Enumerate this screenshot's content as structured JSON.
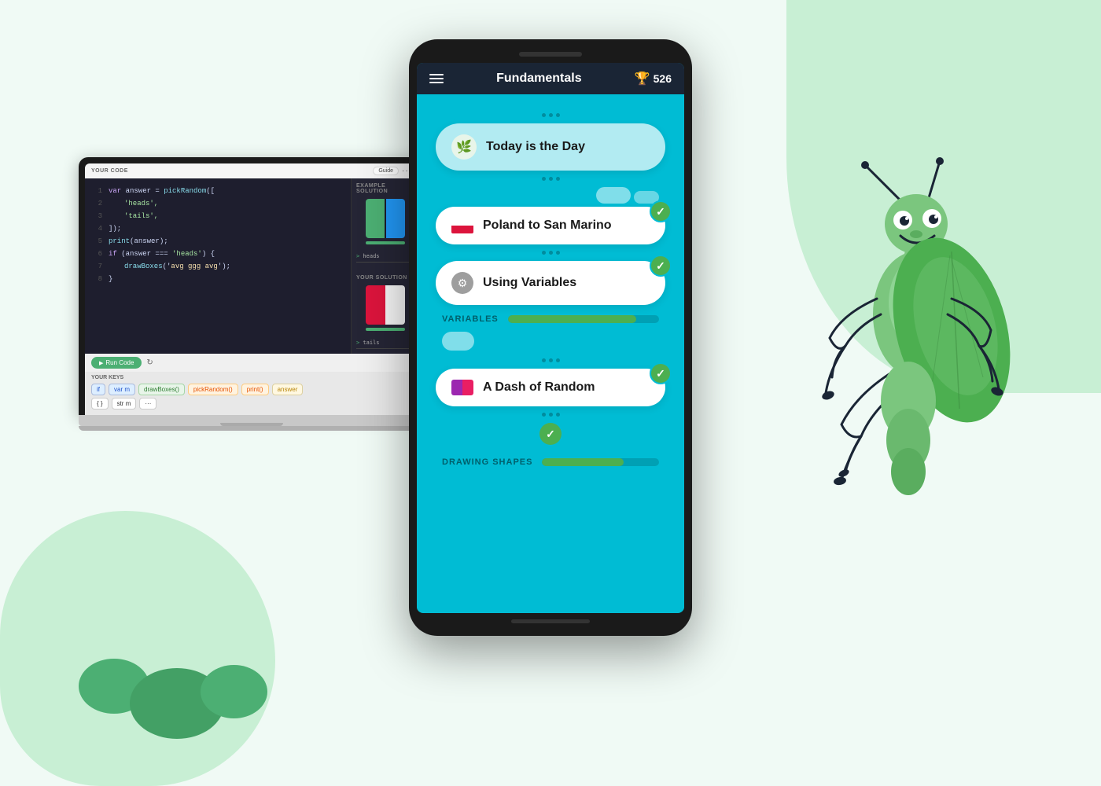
{
  "background": {
    "color": "#f0faf5"
  },
  "phone": {
    "title": "Fundamentals",
    "score": "526",
    "lessons": [
      {
        "id": "today",
        "title": "Today is the Day",
        "icon_type": "leaf",
        "completed": false,
        "active": true
      },
      {
        "id": "poland",
        "title": "Poland to San Marino",
        "icon_type": "flag",
        "completed": true
      },
      {
        "id": "variables",
        "title": "Using Variables",
        "icon_type": "gear",
        "completed": true
      },
      {
        "id": "dash",
        "title": "A Dash of Random",
        "icon_type": "purple",
        "completed": true
      }
    ],
    "sections": [
      {
        "id": "variables",
        "label": "VARIABLES",
        "progress": 85
      },
      {
        "id": "drawing",
        "label": "DRAWING SHAPES",
        "progress": 70
      }
    ]
  },
  "laptop": {
    "your_code_label": "YOUR CODE",
    "guide_label": "Guide",
    "example_solution_label": "EXAMPLE SOLUTION",
    "your_solution_label": "YOUR SOLUTION",
    "run_code_label": "Run Code",
    "your_keys_label": "YOUR KEYS",
    "code_lines": [
      "var answer = pickRandom([",
      "    'heads',",
      "    'tails',",
      "]);",
      "print(answer);",
      "if (answer === 'heads') {",
      "    drawBoxes('avg ggg avg');",
      "}"
    ],
    "keys": [
      {
        "label": "if",
        "type": "blue"
      },
      {
        "label": "var m",
        "type": "blue"
      },
      {
        "label": "drawBoxes()",
        "type": "green"
      },
      {
        "label": "pickRandom()",
        "type": "orange"
      },
      {
        "label": "print()",
        "type": "orange"
      },
      {
        "label": "answer",
        "type": "yellow"
      },
      {
        "label": "{ }",
        "type": "default"
      },
      {
        "label": "str m",
        "type": "default"
      },
      {
        "label": "...",
        "type": "default"
      }
    ],
    "output_lines": [
      {
        "label": "> heads",
        "type": "output"
      },
      {
        "label": "> tails",
        "type": "output"
      }
    ]
  },
  "grasshopper": {
    "body_color": "#7bc67e",
    "dark_color": "#1a2535"
  }
}
